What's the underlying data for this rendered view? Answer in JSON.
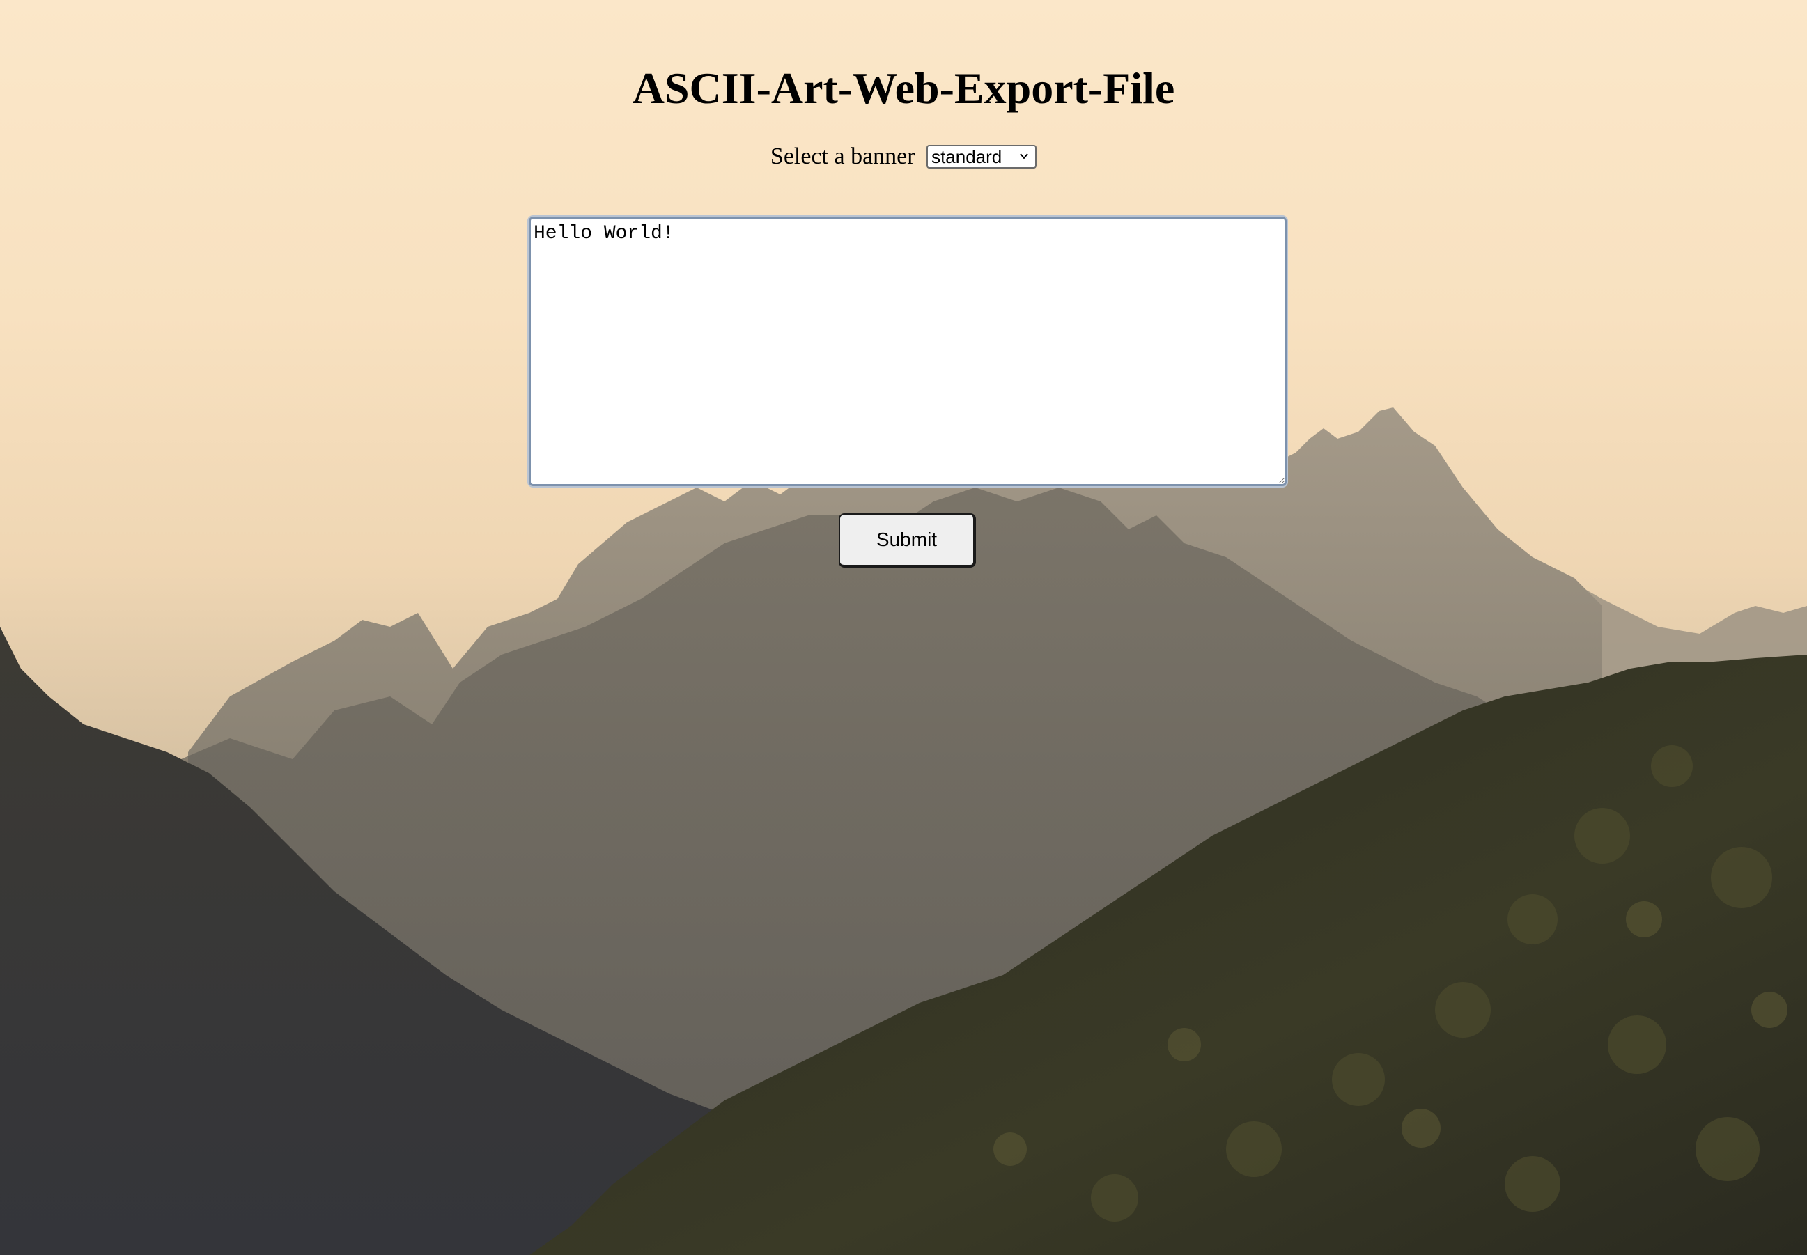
{
  "page": {
    "title": "ASCII-Art-Web-Export-File"
  },
  "banner": {
    "label": "Select a banner",
    "selected": "standard"
  },
  "input": {
    "value": "Hello World!"
  },
  "actions": {
    "submit_label": "Submit"
  },
  "theme": {
    "sky_top": "#fbe7c9",
    "mountain_far": "#8e8578",
    "mountain_mid": "#5e5a52",
    "forest_dark": "#2a2a22",
    "button_bg": "#efefef",
    "textarea_border": "#7d92ad"
  },
  "icons": {
    "select_arrow": "chevron-down-icon",
    "resize_handle": "resize-grip-icon"
  }
}
